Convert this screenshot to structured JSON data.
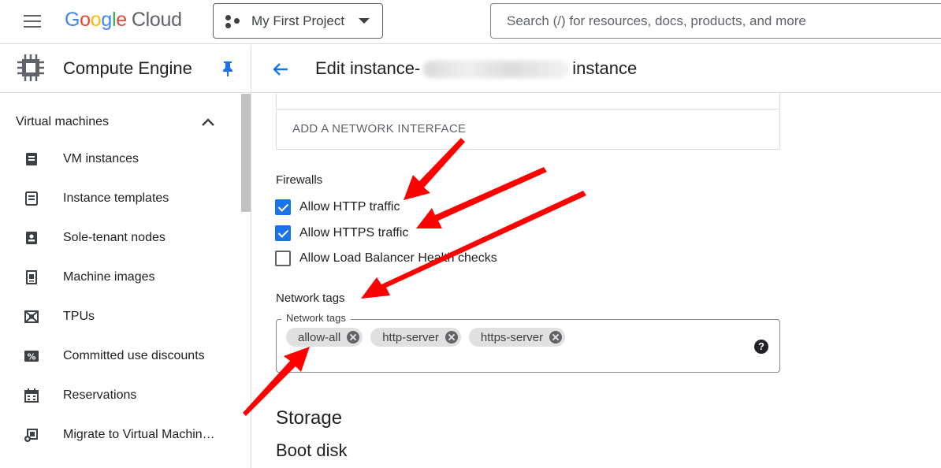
{
  "topbar": {
    "logo_letters": [
      "G",
      "o",
      "o",
      "g",
      "l",
      "e"
    ],
    "logo_product": "Cloud",
    "project_name": "My First Project",
    "search_placeholder": "Search (/) for resources, docs, products, and more"
  },
  "sidebar": {
    "title": "Compute Engine",
    "section": "Virtual machines",
    "items": [
      {
        "label": "VM instances",
        "icon": "vm-instances-icon"
      },
      {
        "label": "Instance templates",
        "icon": "instance-templates-icon"
      },
      {
        "label": "Sole-tenant nodes",
        "icon": "sole-tenant-nodes-icon"
      },
      {
        "label": "Machine images",
        "icon": "machine-images-icon"
      },
      {
        "label": "TPUs",
        "icon": "tpu-icon"
      },
      {
        "label": "Committed use discounts",
        "icon": "discount-icon"
      },
      {
        "label": "Reservations",
        "icon": "calendar-icon"
      },
      {
        "label": "Migrate to Virtual Machin…",
        "icon": "migrate-icon"
      }
    ]
  },
  "main": {
    "title_prefix": "Edit instance-",
    "title_suffix": "instance",
    "add_network_interface": "ADD A NETWORK INTERFACE",
    "firewalls": {
      "label": "Firewalls",
      "options": [
        {
          "label": "Allow HTTP traffic",
          "checked": true
        },
        {
          "label": "Allow HTTPS traffic",
          "checked": true
        },
        {
          "label": "Allow Load Balancer Health checks",
          "checked": false
        }
      ]
    },
    "network_tags": {
      "section_label": "Network tags",
      "field_label": "Network tags",
      "tags": [
        "allow-all",
        "http-server",
        "https-server"
      ],
      "help": "?"
    },
    "storage_heading": "Storage",
    "boot_disk_heading": "Boot disk"
  },
  "colors": {
    "accent": "#1a73e8",
    "annotation_arrow": "#ff0000"
  }
}
